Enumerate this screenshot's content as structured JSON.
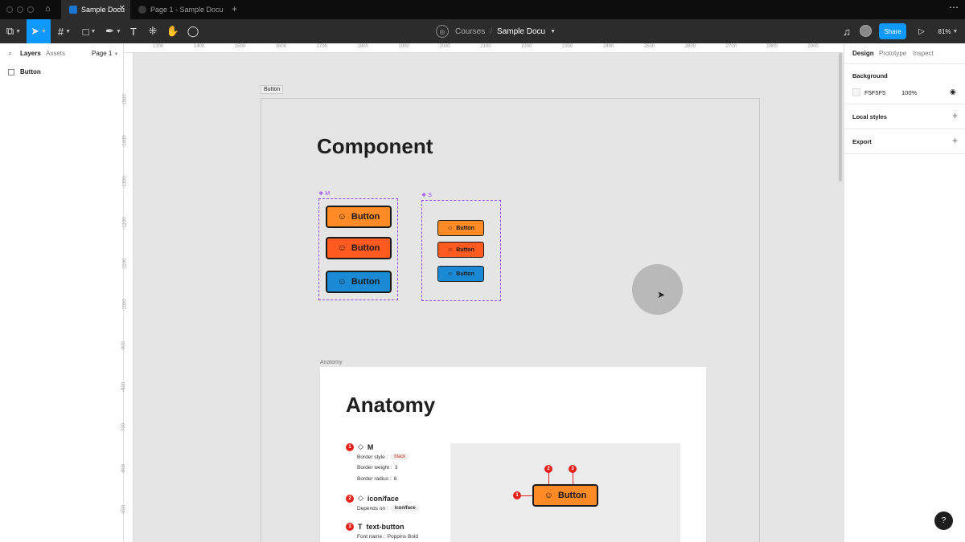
{
  "window": {
    "tabs": [
      {
        "label": "Sample Docu",
        "active": true
      },
      {
        "label": "Page 1 - Sample Docu",
        "active": false
      }
    ]
  },
  "toolbar": {
    "breadcrumb_project": "Courses",
    "breadcrumb_separator": "/",
    "breadcrumb_file": "Sample Docu",
    "share_label": "Share",
    "zoom": "81%"
  },
  "left_panel": {
    "tabs": [
      "Layers",
      "Assets"
    ],
    "page_select": "Page 1",
    "layers": [
      "Button"
    ]
  },
  "rulers": {
    "top": [
      "1300",
      "1400",
      "1500",
      "1600",
      "1700",
      "1800",
      "1900",
      "2000",
      "2100",
      "2200",
      "2300",
      "2400",
      "2500",
      "2600",
      "2700",
      "2800",
      "2900"
    ],
    "left": [
      "-1500",
      "-1400",
      "-1300",
      "-1200",
      "-1100",
      "-1000",
      "-900",
      "-800",
      "-700",
      "-600",
      "-500"
    ]
  },
  "canvas": {
    "frame_label": "Button",
    "component_title": "Component",
    "variant_m_label": "M",
    "variant_s_label": "S",
    "button_label": "Button",
    "button_colors": [
      "#ff8a26",
      "#ff5a1f",
      "#1a8ad4"
    ],
    "anatomy_label": "Anatomy",
    "anatomy_title": "Anatomy",
    "anatomy_items": [
      {
        "num": "1",
        "name": "M",
        "props": [
          {
            "label": "Border style :",
            "value": "black",
            "chip": true
          },
          {
            "label": "Border weight :",
            "value": "3",
            "chip": false
          },
          {
            "label": "Border radius :",
            "value": "8",
            "chip": false
          }
        ]
      },
      {
        "num": "2",
        "name": "icon/face",
        "props": [
          {
            "label": "Depends on :",
            "value": "icon/face",
            "chip": true
          }
        ]
      },
      {
        "num": "3",
        "name": "text-button",
        "props": [
          {
            "label": "Font name :",
            "value": "Poppins Bold",
            "chip": false
          }
        ]
      }
    ],
    "diagram_markers": [
      "1",
      "2",
      "3"
    ]
  },
  "right_panel": {
    "tabs": [
      "Design",
      "Prototype",
      "Inspect"
    ],
    "background_heading": "Background",
    "background_hex": "F5F5F5",
    "background_opacity": "100%",
    "local_styles": "Local styles",
    "export": "Export"
  },
  "help": "?"
}
